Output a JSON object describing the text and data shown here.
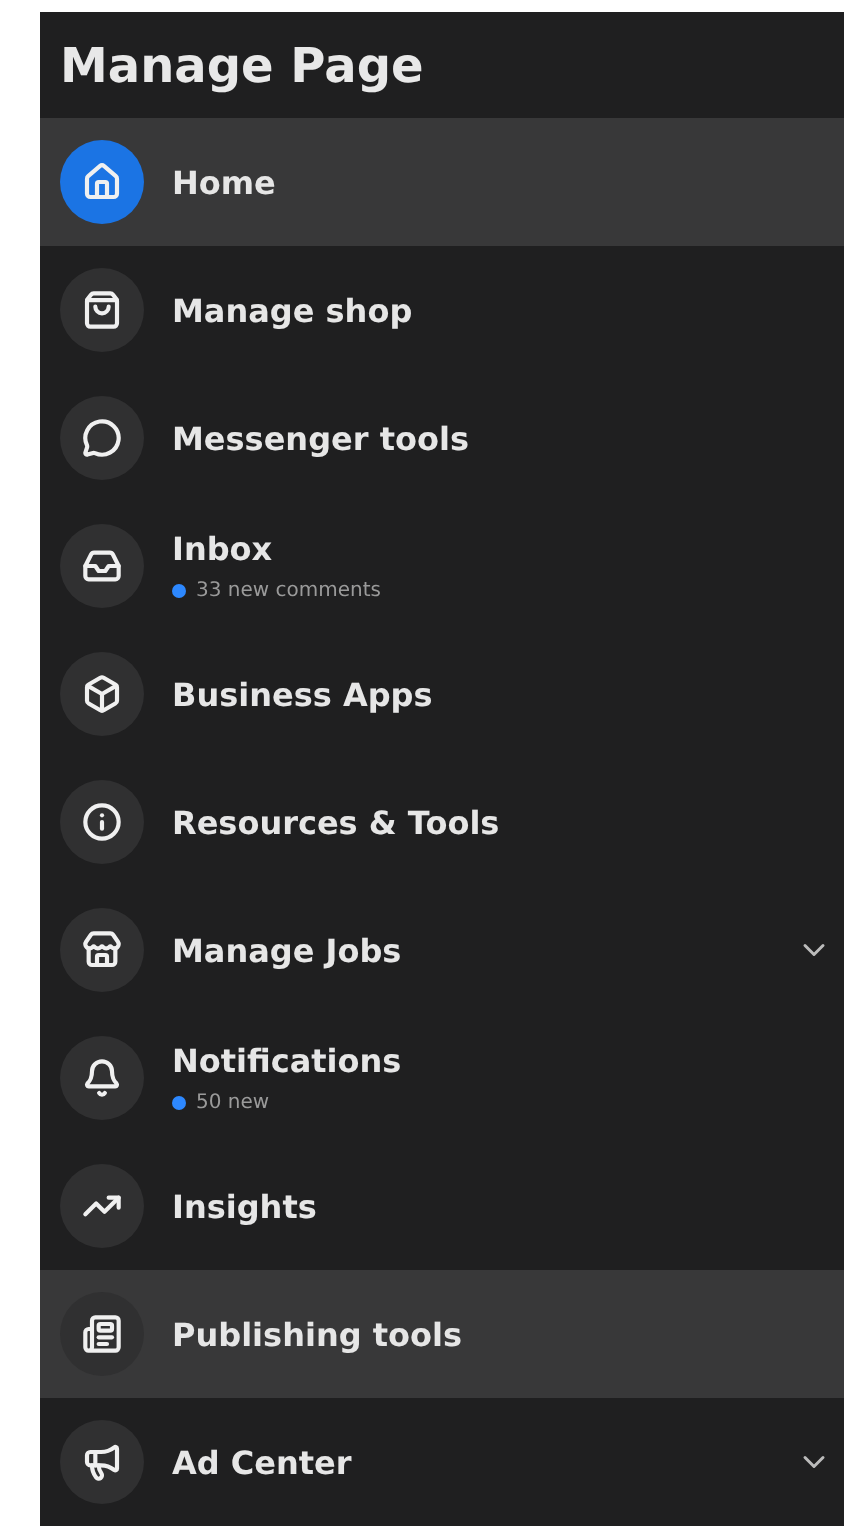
{
  "title": "Manage Page",
  "items": [
    {
      "label": "Home",
      "selected": true,
      "highlighted": true
    },
    {
      "label": "Manage shop",
      "selected": false,
      "highlighted": false
    },
    {
      "label": "Messenger tools",
      "selected": false,
      "highlighted": false
    },
    {
      "label": "Inbox",
      "subtitle": "33 new comments",
      "selected": false,
      "highlighted": false
    },
    {
      "label": "Business Apps",
      "selected": false,
      "highlighted": false
    },
    {
      "label": "Resources & Tools",
      "selected": false,
      "highlighted": false
    },
    {
      "label": "Manage Jobs",
      "selected": false,
      "highlighted": false,
      "expanded": false
    },
    {
      "label": "Notifications",
      "subtitle": "50 new",
      "selected": false,
      "highlighted": false
    },
    {
      "label": "Insights",
      "selected": false,
      "highlighted": false
    },
    {
      "label": "Publishing tools",
      "selected": false,
      "highlighted": true
    },
    {
      "label": "Ad Center",
      "selected": false,
      "highlighted": false,
      "expanded": false
    }
  ]
}
